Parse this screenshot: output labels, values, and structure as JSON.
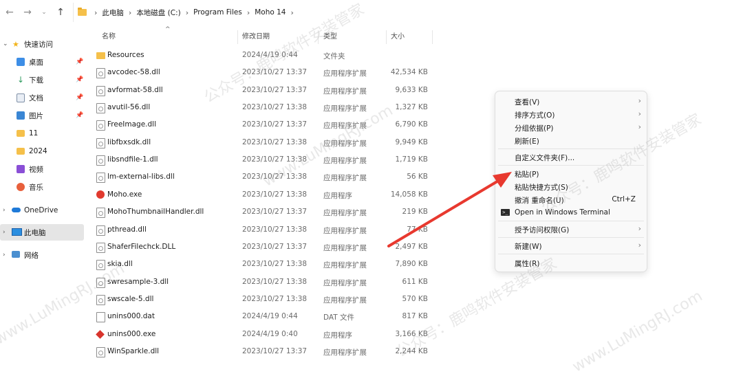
{
  "address_bar": {
    "crumbs": [
      "此电脑",
      "本地磁盘 (C:)",
      "Program Files",
      "Moho 14"
    ]
  },
  "nav_pane": {
    "quick_access": "快速访问",
    "items": [
      {
        "label": "桌面",
        "icon": "desktop-icon",
        "color": "#3d8ee6",
        "pinned": true
      },
      {
        "label": "下载",
        "icon": "download-icon",
        "color": "#2e9b5f",
        "pinned": true
      },
      {
        "label": "文档",
        "icon": "document-icon",
        "color": "#7e8fa6",
        "pinned": true
      },
      {
        "label": "图片",
        "icon": "picture-icon",
        "color": "#3a86d4",
        "pinned": true
      },
      {
        "label": "11",
        "icon": "folder-icon",
        "color": "#f5c04a",
        "pinned": false
      },
      {
        "label": "2024",
        "icon": "folder-icon",
        "color": "#f5c04a",
        "pinned": false
      },
      {
        "label": "视频",
        "icon": "video-icon",
        "color": "#8a4fd6",
        "pinned": false
      },
      {
        "label": "音乐",
        "icon": "music-icon",
        "color": "#e8603c",
        "pinned": false
      }
    ],
    "onedrive": "OneDrive",
    "this_pc": "此电脑",
    "network": "网络"
  },
  "columns": {
    "name": "名称",
    "date": "修改日期",
    "type": "类型",
    "size": "大小"
  },
  "files": [
    {
      "name": "Resources",
      "date": "2024/4/19 0:44",
      "type": "文件夹",
      "size": "",
      "icon": "folder"
    },
    {
      "name": "avcodec-58.dll",
      "date": "2023/10/27 13:37",
      "type": "应用程序扩展",
      "size": "42,534 KB",
      "icon": "dll"
    },
    {
      "name": "avformat-58.dll",
      "date": "2023/10/27 13:37",
      "type": "应用程序扩展",
      "size": "9,633 KB",
      "icon": "dll"
    },
    {
      "name": "avutil-56.dll",
      "date": "2023/10/27 13:38",
      "type": "应用程序扩展",
      "size": "1,327 KB",
      "icon": "dll"
    },
    {
      "name": "FreeImage.dll",
      "date": "2023/10/27 13:37",
      "type": "应用程序扩展",
      "size": "6,790 KB",
      "icon": "dll"
    },
    {
      "name": "libfbxsdk.dll",
      "date": "2023/10/27 13:38",
      "type": "应用程序扩展",
      "size": "9,949 KB",
      "icon": "dll"
    },
    {
      "name": "libsndfile-1.dll",
      "date": "2023/10/27 13:38",
      "type": "应用程序扩展",
      "size": "1,719 KB",
      "icon": "dll"
    },
    {
      "name": "lm-external-libs.dll",
      "date": "2023/10/27 13:38",
      "type": "应用程序扩展",
      "size": "56 KB",
      "icon": "dll"
    },
    {
      "name": "Moho.exe",
      "date": "2023/10/27 13:38",
      "type": "应用程序",
      "size": "14,058 KB",
      "icon": "moho"
    },
    {
      "name": "MohoThumbnailHandler.dll",
      "date": "2023/10/27 13:37",
      "type": "应用程序扩展",
      "size": "219 KB",
      "icon": "dll"
    },
    {
      "name": "pthread.dll",
      "date": "2023/10/27 13:38",
      "type": "应用程序扩展",
      "size": "77 KB",
      "icon": "dll"
    },
    {
      "name": "ShaferFilechck.DLL",
      "date": "2023/10/27 13:37",
      "type": "应用程序扩展",
      "size": "2,497 KB",
      "icon": "dll"
    },
    {
      "name": "skia.dll",
      "date": "2023/10/27 13:38",
      "type": "应用程序扩展",
      "size": "7,890 KB",
      "icon": "dll"
    },
    {
      "name": "swresample-3.dll",
      "date": "2023/10/27 13:38",
      "type": "应用程序扩展",
      "size": "611 KB",
      "icon": "dll"
    },
    {
      "name": "swscale-5.dll",
      "date": "2023/10/27 13:38",
      "type": "应用程序扩展",
      "size": "570 KB",
      "icon": "dll"
    },
    {
      "name": "unins000.dat",
      "date": "2024/4/19 0:44",
      "type": "DAT 文件",
      "size": "817 KB",
      "icon": "dat"
    },
    {
      "name": "unins000.exe",
      "date": "2024/4/19 0:40",
      "type": "应用程序",
      "size": "3,166 KB",
      "icon": "unins"
    },
    {
      "name": "WinSparkle.dll",
      "date": "2023/10/27 13:37",
      "type": "应用程序扩展",
      "size": "2,244 KB",
      "icon": "dll"
    }
  ],
  "context_menu": {
    "view": "查看(V)",
    "sort": "排序方式(O)",
    "group": "分组依据(P)",
    "refresh": "刷新(E)",
    "customize": "自定义文件夹(F)...",
    "paste": "粘贴(P)",
    "paste_shortcut": "粘贴快捷方式(S)",
    "undo_rename": "撤消 重命名(U)",
    "undo_shortcut": "Ctrl+Z",
    "terminal": "Open in Windows Terminal",
    "grant_access": "授予访问权限(G)",
    "new": "新建(W)",
    "properties": "属性(R)"
  },
  "annotation": {
    "arrow_color": "#e8392f"
  },
  "watermark": {
    "text_a": "www.LuMingRJ.com",
    "text_b": "公众号：鹿鸣软件安装管家"
  }
}
